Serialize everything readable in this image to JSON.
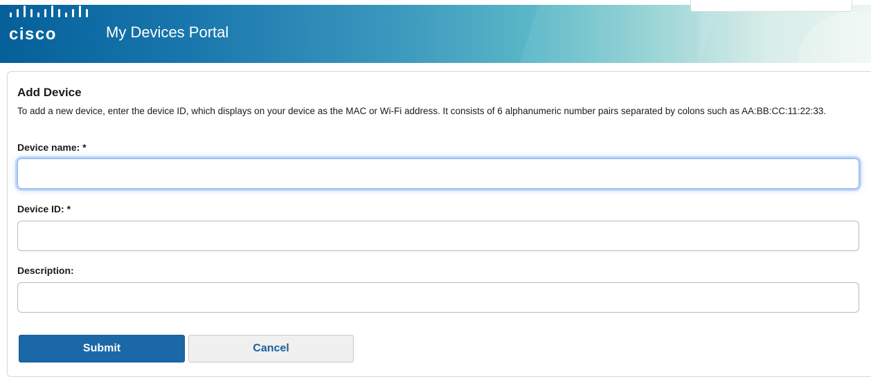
{
  "header": {
    "brand": "cisco",
    "portal_title": "My Devices Portal"
  },
  "form": {
    "title": "Add Device",
    "intro": "To add a new device, enter the device ID, which displays on your device as the MAC or Wi-Fi address. It consists of 6 alphanumeric number pairs separated by colons such as AA:BB:CC:11:22:33.",
    "fields": [
      {
        "label": "Device name: *",
        "value": ""
      },
      {
        "label": "Device ID: *",
        "value": ""
      },
      {
        "label": "Description:",
        "value": ""
      }
    ],
    "submit_label": "Submit",
    "cancel_label": "Cancel"
  },
  "colors": {
    "primary_button": "#1b68a8",
    "header_start": "#05609a",
    "header_end": "#edf6f2"
  }
}
